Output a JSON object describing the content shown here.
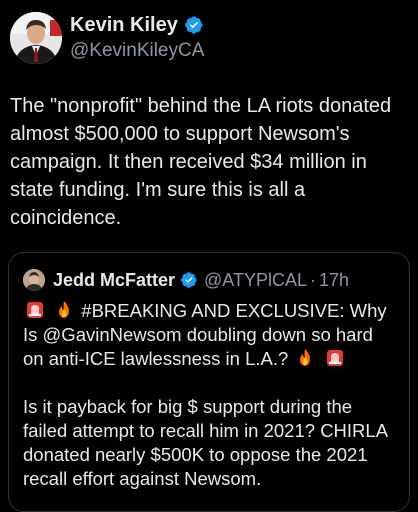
{
  "tweet": {
    "author": {
      "display_name": "Kevin Kiley",
      "handle": "@KevinKileyCA",
      "verified": true,
      "avatar_icon": "profile-photo-avatar"
    },
    "text": "The \"nonprofit\" behind the LA riots donated almost $500,000 to support Newsom's campaign. It then received $34 million in state funding. I'm sure this is all a coincidence."
  },
  "quoted_tweet": {
    "author": {
      "display_name": "Jedd McFatter",
      "handle": "@ATYPlCAL",
      "verified": true,
      "avatar_icon": "profile-photo-avatar"
    },
    "separator": "·",
    "time": "17h",
    "line1_text": "#BREAKING AND EXCLUSIVE: Why Is @GavinNewsom doubling down so hard on anti-ICE lawlessness in L.A.?",
    "line1_leading_emojis": [
      "siren-emoji",
      "fire-emoji"
    ],
    "line1_trailing_emojis": [
      "fire-emoji",
      "siren-emoji"
    ],
    "paragraph2": "Is it payback for big $ support during the failed attempt to recall him in 2021? CHIRLA donated nearly $500K to oppose the 2021 recall effort against Newsom."
  },
  "colors": {
    "background": "#000000",
    "text_primary": "#e7e9ea",
    "text_secondary": "#8b98a5",
    "verified_badge": "#1d9bf0",
    "border": "#2f3336"
  }
}
